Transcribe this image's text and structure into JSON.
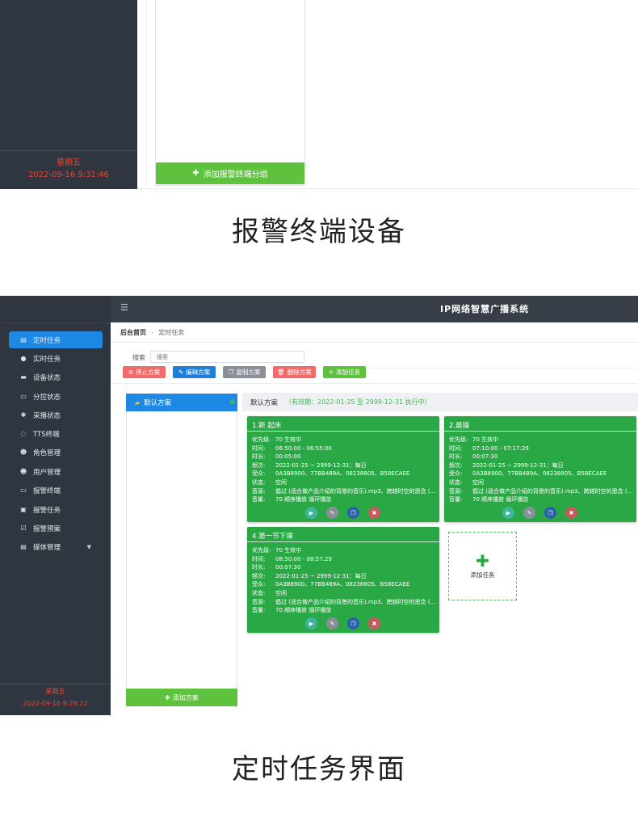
{
  "top": {
    "day": "星期五",
    "datetime": "2022-09-16 9:31:46",
    "add_group_label": "添加报警终端分组"
  },
  "caption1": "报警终端设备",
  "app": {
    "title": "IP网络智慧广播系统",
    "breadcrumb": {
      "home": "后台首页",
      "current": "定时任务"
    }
  },
  "sidebar": {
    "items": [
      {
        "label": "定时任务",
        "icon": "document-icon"
      },
      {
        "label": "实时任务",
        "icon": "pin-icon"
      },
      {
        "label": "设备状态",
        "icon": "monitor-icon"
      },
      {
        "label": "分控状态",
        "icon": "folder-icon"
      },
      {
        "label": "采播状态",
        "icon": "gear-icon"
      },
      {
        "label": "TTS终端",
        "icon": "chat-icon"
      },
      {
        "label": "角色管理",
        "icon": "user-icon"
      },
      {
        "label": "用户管理",
        "icon": "user-icon"
      },
      {
        "label": "报警终端",
        "icon": "monitor-icon"
      },
      {
        "label": "报警任务",
        "icon": "image-icon"
      },
      {
        "label": "报警预案",
        "icon": "check-box-icon"
      },
      {
        "label": "媒体管理",
        "icon": "list-icon"
      }
    ],
    "day": "星期五",
    "datetime": "2022-09-16 9:29:22"
  },
  "search": {
    "label": "搜索",
    "placeholder": "搜索"
  },
  "toolbar": {
    "stop": "停止方案",
    "edit": "编辑方案",
    "copy": "复制方案",
    "delete": "删除方案",
    "add_task": "添加任务"
  },
  "colors": {
    "stop": "#f16b6b",
    "edit": "#1f7fd8",
    "copy": "#8a8f97",
    "delete": "#f16b6b",
    "add_task": "#5ec23e"
  },
  "plans": {
    "item": "默认方案",
    "add": "添加方案"
  },
  "plan_header": {
    "name": "默认方案",
    "validity": "（有效期：2022-01-25 至 2999-12-31 执行中）"
  },
  "cards": [
    {
      "title": "1.新 起床",
      "rows": [
        {
          "k": "优先级:",
          "v": "70   生效中"
        },
        {
          "k": "时间:",
          "v": "06:50:00 - 06:55:00"
        },
        {
          "k": "时长:",
          "v": "00:05:00"
        },
        {
          "k": "频次:",
          "v": "2022-01-25 ~ 2999-12-31：每日"
        },
        {
          "k": "受众:",
          "v": "0A3B8900、77BB489A、08238805、B58ECAEE"
        },
        {
          "k": "状态:",
          "v": "空闲"
        },
        {
          "k": "音源:",
          "v": "倡过 (适合做产品介绍的背景的音乐).mp3、跨越时空的思念 (鹿..."
        },
        {
          "k": "音量:",
          "v": "70 顺序播放 循环播放"
        }
      ]
    },
    {
      "title": "2.晨操",
      "rows": [
        {
          "k": "优先级:",
          "v": "70   生效中"
        },
        {
          "k": "时间:",
          "v": "07:10:00 - 07:17:29"
        },
        {
          "k": "时长:",
          "v": "00:07:30"
        },
        {
          "k": "频次:",
          "v": "2022-01-25 ~ 2999-12-31：每日"
        },
        {
          "k": "受众:",
          "v": "0A3B8900、77BB489A、08238805、B58ECAEE"
        },
        {
          "k": "状态:",
          "v": "空闲"
        },
        {
          "k": "音源:",
          "v": "倡过 (适合做产品介绍的背景的音乐).mp3、跨越时空的思念 (鹿..."
        },
        {
          "k": "音量:",
          "v": "70 顺序播放 循环播放"
        }
      ]
    },
    {
      "title": "4.第一节下课",
      "rows": [
        {
          "k": "优先级:",
          "v": "70   生效中"
        },
        {
          "k": "时间:",
          "v": "08:50:00 - 08:57:29"
        },
        {
          "k": "时长:",
          "v": "00:07:30"
        },
        {
          "k": "频次:",
          "v": "2022-01-25 ~ 2999-12-31：每日"
        },
        {
          "k": "受众:",
          "v": "0A3B8900、77BB489A、08238805、B58ECAEE"
        },
        {
          "k": "状态:",
          "v": "空闲"
        },
        {
          "k": "音源:",
          "v": "倡过 (适合做产品介绍的背景的音乐).mp3、跨越时空的思念 (鹿..."
        },
        {
          "k": "音量:",
          "v": "70 顺序播放 循环播放"
        }
      ]
    }
  ],
  "add_task_card": "添加任务",
  "caption2": "定时任务界面"
}
